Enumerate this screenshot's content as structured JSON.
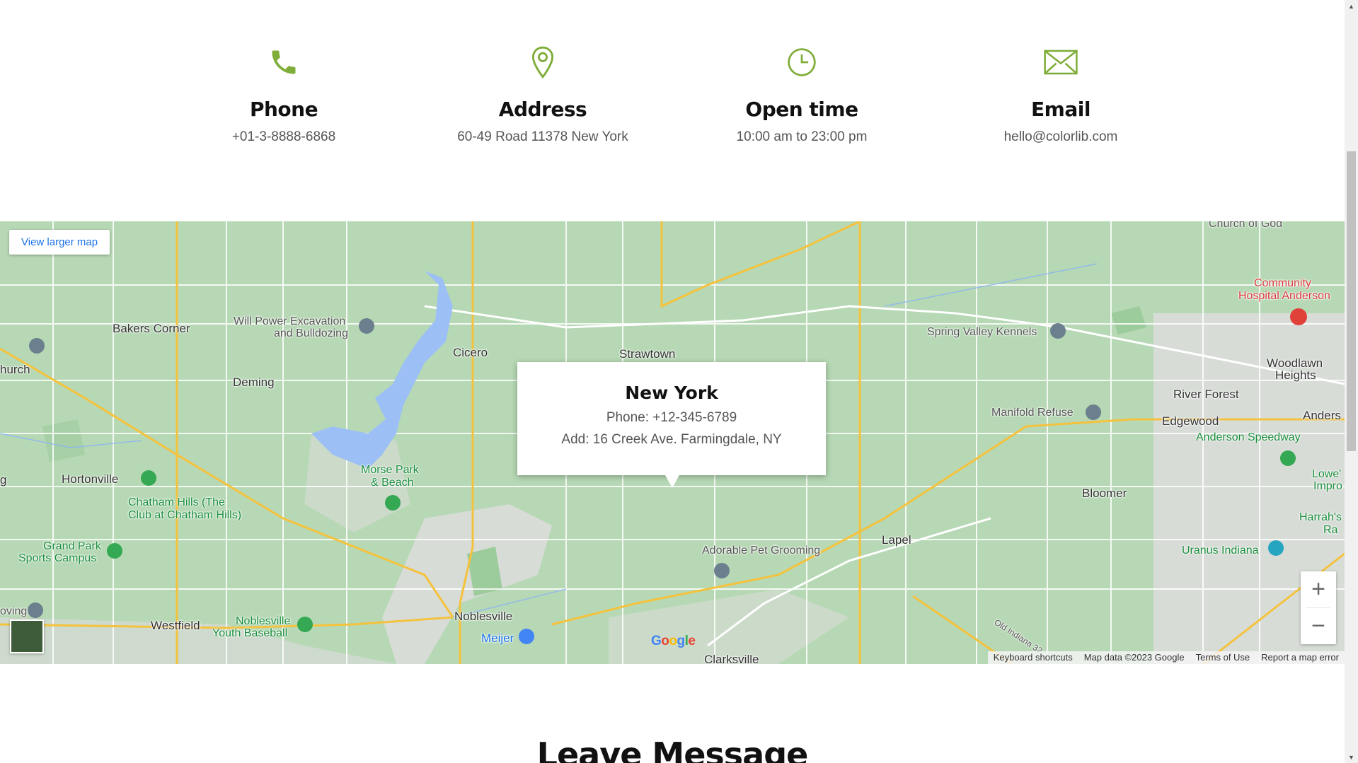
{
  "accent_color": "#7fad39",
  "contact": [
    {
      "icon": "phone-icon",
      "title": "Phone",
      "value": "+01-3-8888-6868"
    },
    {
      "icon": "map-pin-icon",
      "title": "Address",
      "value": "60-49 Road 11378 New York"
    },
    {
      "icon": "clock-icon",
      "title": "Open time",
      "value": "10:00 am to 23:00 pm"
    },
    {
      "icon": "envelope-icon",
      "title": "Email",
      "value": "hello@colorlib.com"
    }
  ],
  "map": {
    "larger_map_label": "View larger map",
    "popup": {
      "title": "New York",
      "phone": "Phone: +12-345-6789",
      "address": "Add: 16 Creek Ave. Farmingdale, NY"
    },
    "places": {
      "bakers_corner": "Bakers Corner",
      "will_power_1": "Will Power Excavation",
      "will_power_2": "and Bulldozing",
      "cicero": "Cicero",
      "strawtown": "Strawtown",
      "deming": "Deming",
      "hortonville": "Hortonville",
      "chatham_1": "Chatham Hills (The",
      "chatham_2": "Club at Chatham Hills)",
      "morse_1": "Morse Park",
      "morse_2": "& Beach",
      "grand_park_1": "Grand Park",
      "grand_park_2": "Sports Campus",
      "westfield": "Westfield",
      "noblesville_yb_1": "Noblesville",
      "noblesville_yb_2": "Youth Baseball",
      "noblesville": "Noblesville",
      "meijer": "Meijer",
      "clarksville": "Clarksville",
      "adorable": "Adorable Pet Grooming",
      "lapel": "Lapel",
      "bloomer": "Bloomer",
      "spring_valley": "Spring Valley Kennels",
      "manifold": "Manifold Refuse",
      "edgewood": "Edgewood",
      "river_forest": "River Forest",
      "woodlawn_1": "Woodlawn",
      "woodlawn_2": "Heights",
      "community_1": "Community",
      "community_2": "Hospital Anderson",
      "church": "Church of God",
      "anderson_speedway": "Anderson Speedway",
      "uranus": "Uranus Indiana",
      "harrahs_1": "Harrah's",
      "harrahs_2": "Ra",
      "lowes_1": "Lowe'",
      "lowes_2": "Impro",
      "anders": "Anders",
      "church_left": "hurch",
      "g_left": "g",
      "loving": "oving",
      "old_indiana": "Old Indiana 32"
    },
    "zoom_in": "+",
    "zoom_out": "−",
    "google_logo": "Google",
    "attribution": [
      "Keyboard shortcuts",
      "Map data ©2023 Google",
      "Terms of Use",
      "Report a map error"
    ]
  },
  "leave_message_heading": "Leave Message"
}
